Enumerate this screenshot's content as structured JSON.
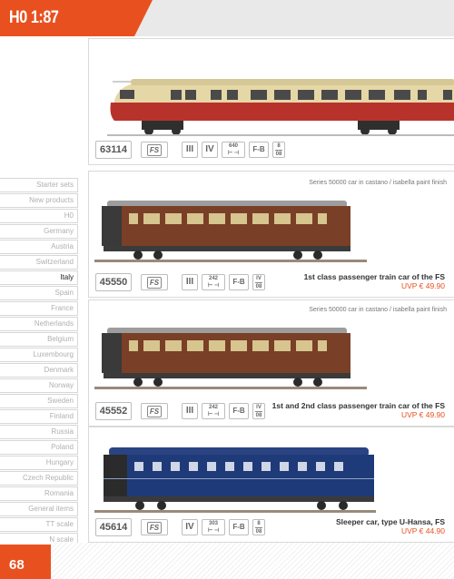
{
  "header": {
    "title": "H0 1:87"
  },
  "sidebar": {
    "items": [
      {
        "label": "Starter sets"
      },
      {
        "label": "New products"
      },
      {
        "label": "H0"
      },
      {
        "label": "Germany"
      },
      {
        "label": "Austria"
      },
      {
        "label": "Switzerland"
      },
      {
        "label": "Italy"
      },
      {
        "label": "Spain"
      },
      {
        "label": "France"
      },
      {
        "label": "Netherlands"
      },
      {
        "label": "Belgium"
      },
      {
        "label": "Luxembourg"
      },
      {
        "label": "Denmark"
      },
      {
        "label": "Norway"
      },
      {
        "label": "Sweden"
      },
      {
        "label": "Finland"
      },
      {
        "label": "Russia"
      },
      {
        "label": "Poland"
      },
      {
        "label": "Hungary"
      },
      {
        "label": "Czech Republic"
      },
      {
        "label": "Romania"
      },
      {
        "label": "General items"
      },
      {
        "label": "TT scale"
      },
      {
        "label": "N scale"
      }
    ],
    "active": "Italy"
  },
  "page_number": "68",
  "products": [
    {
      "art_no": "63114",
      "railway": "FS",
      "epochs": [
        "III",
        "IV"
      ],
      "length": "640",
      "coupling": "F-B",
      "frac_top": "8",
      "frac_bottom": "08",
      "note": "",
      "name": "",
      "price": "",
      "colors": {
        "body": "#b8322c",
        "upper": "#e8dcb0"
      }
    },
    {
      "art_no": "45550",
      "railway": "FS",
      "epochs": [
        "III"
      ],
      "length": "242",
      "coupling": "F-B",
      "frac_top": "IV",
      "frac_bottom": "08",
      "note": "Series 50000 car in castano / isabella paint finish",
      "name": "1st class passenger train car of the FS",
      "price": "UVP € 49.90",
      "colors": {
        "body": "#7a3f27"
      }
    },
    {
      "art_no": "45552",
      "railway": "FS",
      "epochs": [
        "III"
      ],
      "length": "242",
      "coupling": "F-B",
      "frac_top": "IV",
      "frac_bottom": "08",
      "note": "Series 50000 car in castano / isabella paint finish",
      "name": "1st and 2nd class passenger train car of the FS",
      "price": "UVP € 49.90",
      "colors": {
        "body": "#7a3f27"
      }
    },
    {
      "art_no": "45614",
      "railway": "FS",
      "epochs": [
        "IV"
      ],
      "length": "303",
      "coupling": "F-B",
      "frac_top": "8",
      "frac_bottom": "08",
      "note": "",
      "name": "Sleeper car, type U-Hansa, FS",
      "price": "UVP € 44.90",
      "colors": {
        "body": "#1f3a78"
      }
    }
  ]
}
